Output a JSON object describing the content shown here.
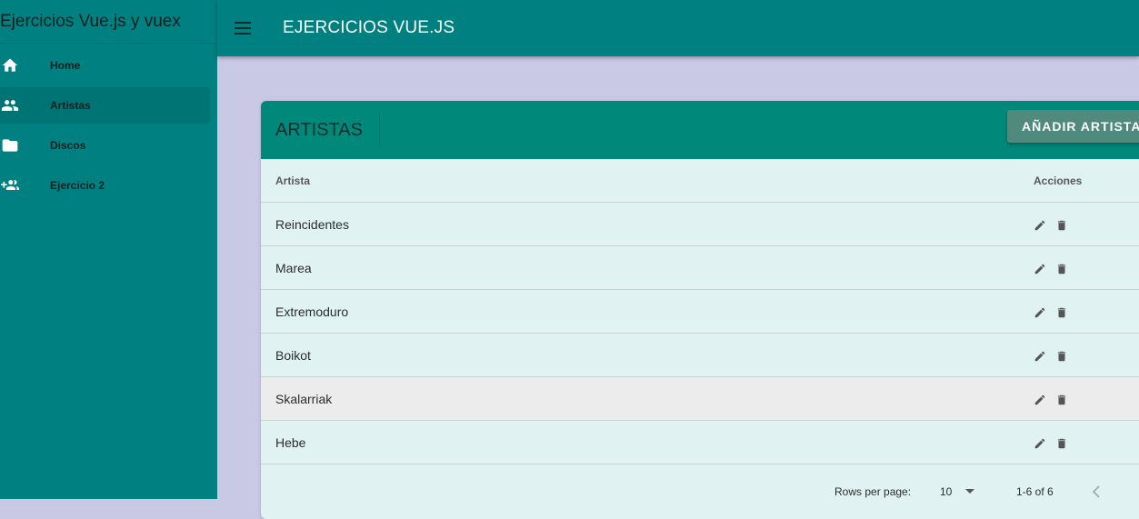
{
  "app": {
    "drawer_title": "Ejercicios Vue.js y vuex",
    "toolbar_title": "EJERCICIOS VUE.JS"
  },
  "sidebar": {
    "items": [
      {
        "label": "Home",
        "icon": "home-icon"
      },
      {
        "label": "Artistas",
        "icon": "people-icon",
        "active": true
      },
      {
        "label": "Discos",
        "icon": "folder-icon"
      },
      {
        "label": "Ejercicio 2",
        "icon": "group-add-icon"
      }
    ]
  },
  "card": {
    "title": "ARTISTAS",
    "add_button": "AÑADIR ARTISTA"
  },
  "table": {
    "headers": {
      "name": "Artista",
      "actions": "Acciones"
    },
    "rows": [
      "Reincidentes",
      "Marea",
      "Extremoduro",
      "Boikot",
      "Skalarriak",
      "Hebe"
    ],
    "hovered_row": 4
  },
  "footer": {
    "rows_label": "Rows per page:",
    "rows_value": "10",
    "range": "1-6 of 6"
  },
  "colors": {
    "primary": "#008080",
    "card_header": "#00897b",
    "background": "#c9c9e6",
    "table_bg": "#e0f2f1"
  }
}
